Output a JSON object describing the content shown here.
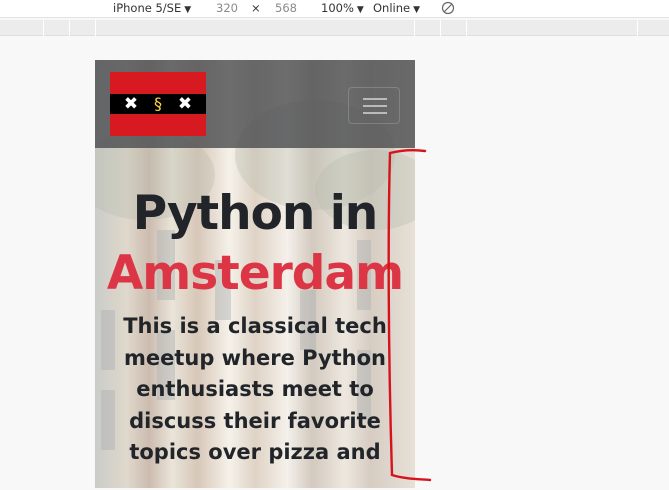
{
  "devtools": {
    "device": "iPhone 5/SE",
    "width": "320",
    "times": "×",
    "height": "568",
    "zoom": "100%",
    "throttle": "Online",
    "caret": "▼"
  },
  "site": {
    "title_line1": "Python in",
    "title_line2": "Amsterdam",
    "lead": "This is a classical tech meetup where Python enthusiasts meet to discuss their favorite topics over pizza and",
    "colors": {
      "accent": "#dc3545",
      "text": "#212529",
      "flag_red": "#d71a21"
    }
  },
  "icons": {
    "rotate": "rotate-icon",
    "menu": "hamburger-menu-icon",
    "logo": "amsterdam-python-logo"
  }
}
